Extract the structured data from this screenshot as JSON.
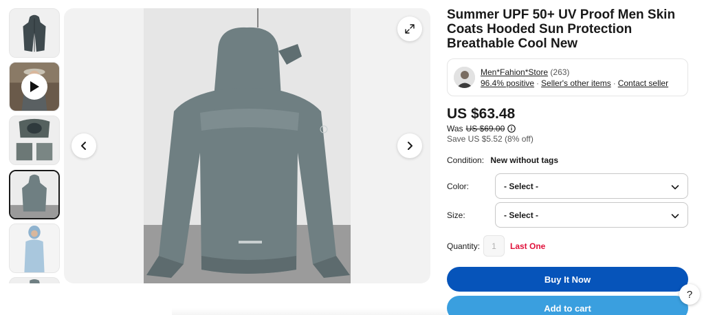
{
  "gallery": {
    "thumbnails": [
      {
        "icon": "jacket-front-photo",
        "selected": false
      },
      {
        "icon": "video-thumbnail",
        "selected": false,
        "has_play": true
      },
      {
        "icon": "hood-detail-photo",
        "selected": false
      },
      {
        "icon": "jacket-back-photo",
        "selected": true
      },
      {
        "icon": "model-wearing-photo",
        "selected": false
      },
      {
        "icon": "jacket-partial-photo",
        "selected": false
      }
    ],
    "main_image": "jacket-back-photo",
    "prev_icon": "chevron-left-icon",
    "next_icon": "chevron-right-icon",
    "expand_icon": "expand-icon"
  },
  "product": {
    "title": "Summer UPF 50+ UV Proof Men Skin Coats Hooded Sun Protection Breathable Cool New"
  },
  "seller": {
    "name": "Men*Fahion*Store",
    "feedback_count": "(263)",
    "positive": "96.4% positive",
    "other_items": "Seller's other items",
    "contact": "Contact seller"
  },
  "pricing": {
    "price": "US $63.48",
    "was_label": "Was",
    "was_price": "US $69.00",
    "save": "Save US $5.52 (8% off)"
  },
  "condition": {
    "label": "Condition:",
    "value": "New without tags"
  },
  "options": {
    "color_label": "Color:",
    "color_value": "- Select -",
    "size_label": "Size:",
    "size_value": "- Select -"
  },
  "quantity": {
    "label": "Quantity:",
    "value": "1",
    "stock_note": "Last One"
  },
  "actions": {
    "buy_now": "Buy It Now",
    "add_to_cart": "Add to cart",
    "help": "?"
  },
  "colors": {
    "buy_now_bg": "#0654ba",
    "add_to_cart_bg": "#3a9fdf",
    "last_one": "#e0103a",
    "jacket": "#6f7f82"
  }
}
